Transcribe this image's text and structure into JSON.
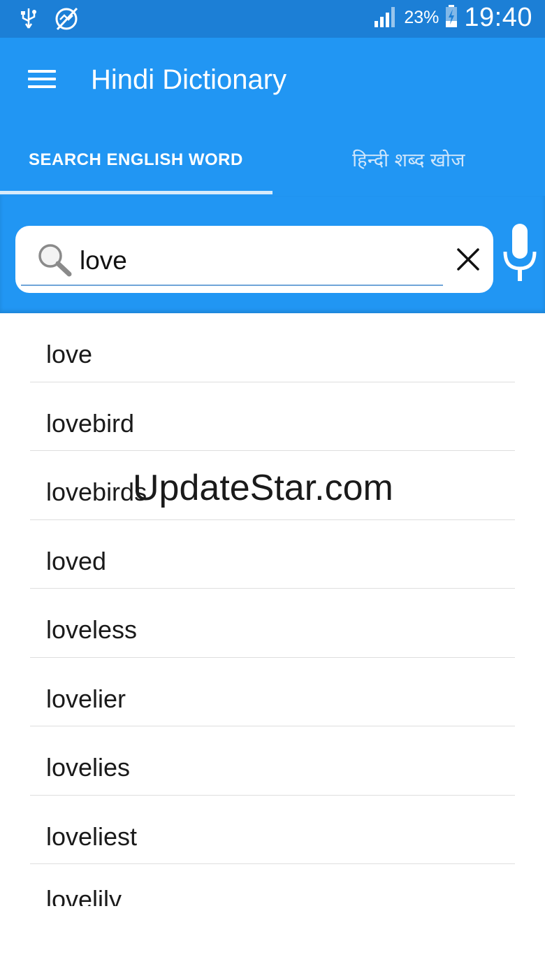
{
  "status_bar": {
    "battery_percent": "23%",
    "time": "19:40",
    "icons": [
      "usb-icon",
      "sync-disabled-icon",
      "signal-icon",
      "battery-charging-icon"
    ]
  },
  "app_bar": {
    "title": "Hindi Dictionary",
    "menu_icon": "hamburger-menu-icon",
    "background": "#2196f3"
  },
  "tabs": [
    {
      "label": "SEARCH  ENGLISH  WORD",
      "active": true
    },
    {
      "label": "हिन्दी शब्द खोज",
      "active": false
    }
  ],
  "search": {
    "value": "love",
    "icons": [
      "search-icon",
      "clear-icon",
      "mic-icon"
    ]
  },
  "results": [
    "love",
    "lovebird",
    "lovebirds",
    "loved",
    "loveless",
    "lovelier",
    "lovelies",
    "loveliest",
    "lovelily"
  ],
  "watermark": "UpdateStar.com"
}
